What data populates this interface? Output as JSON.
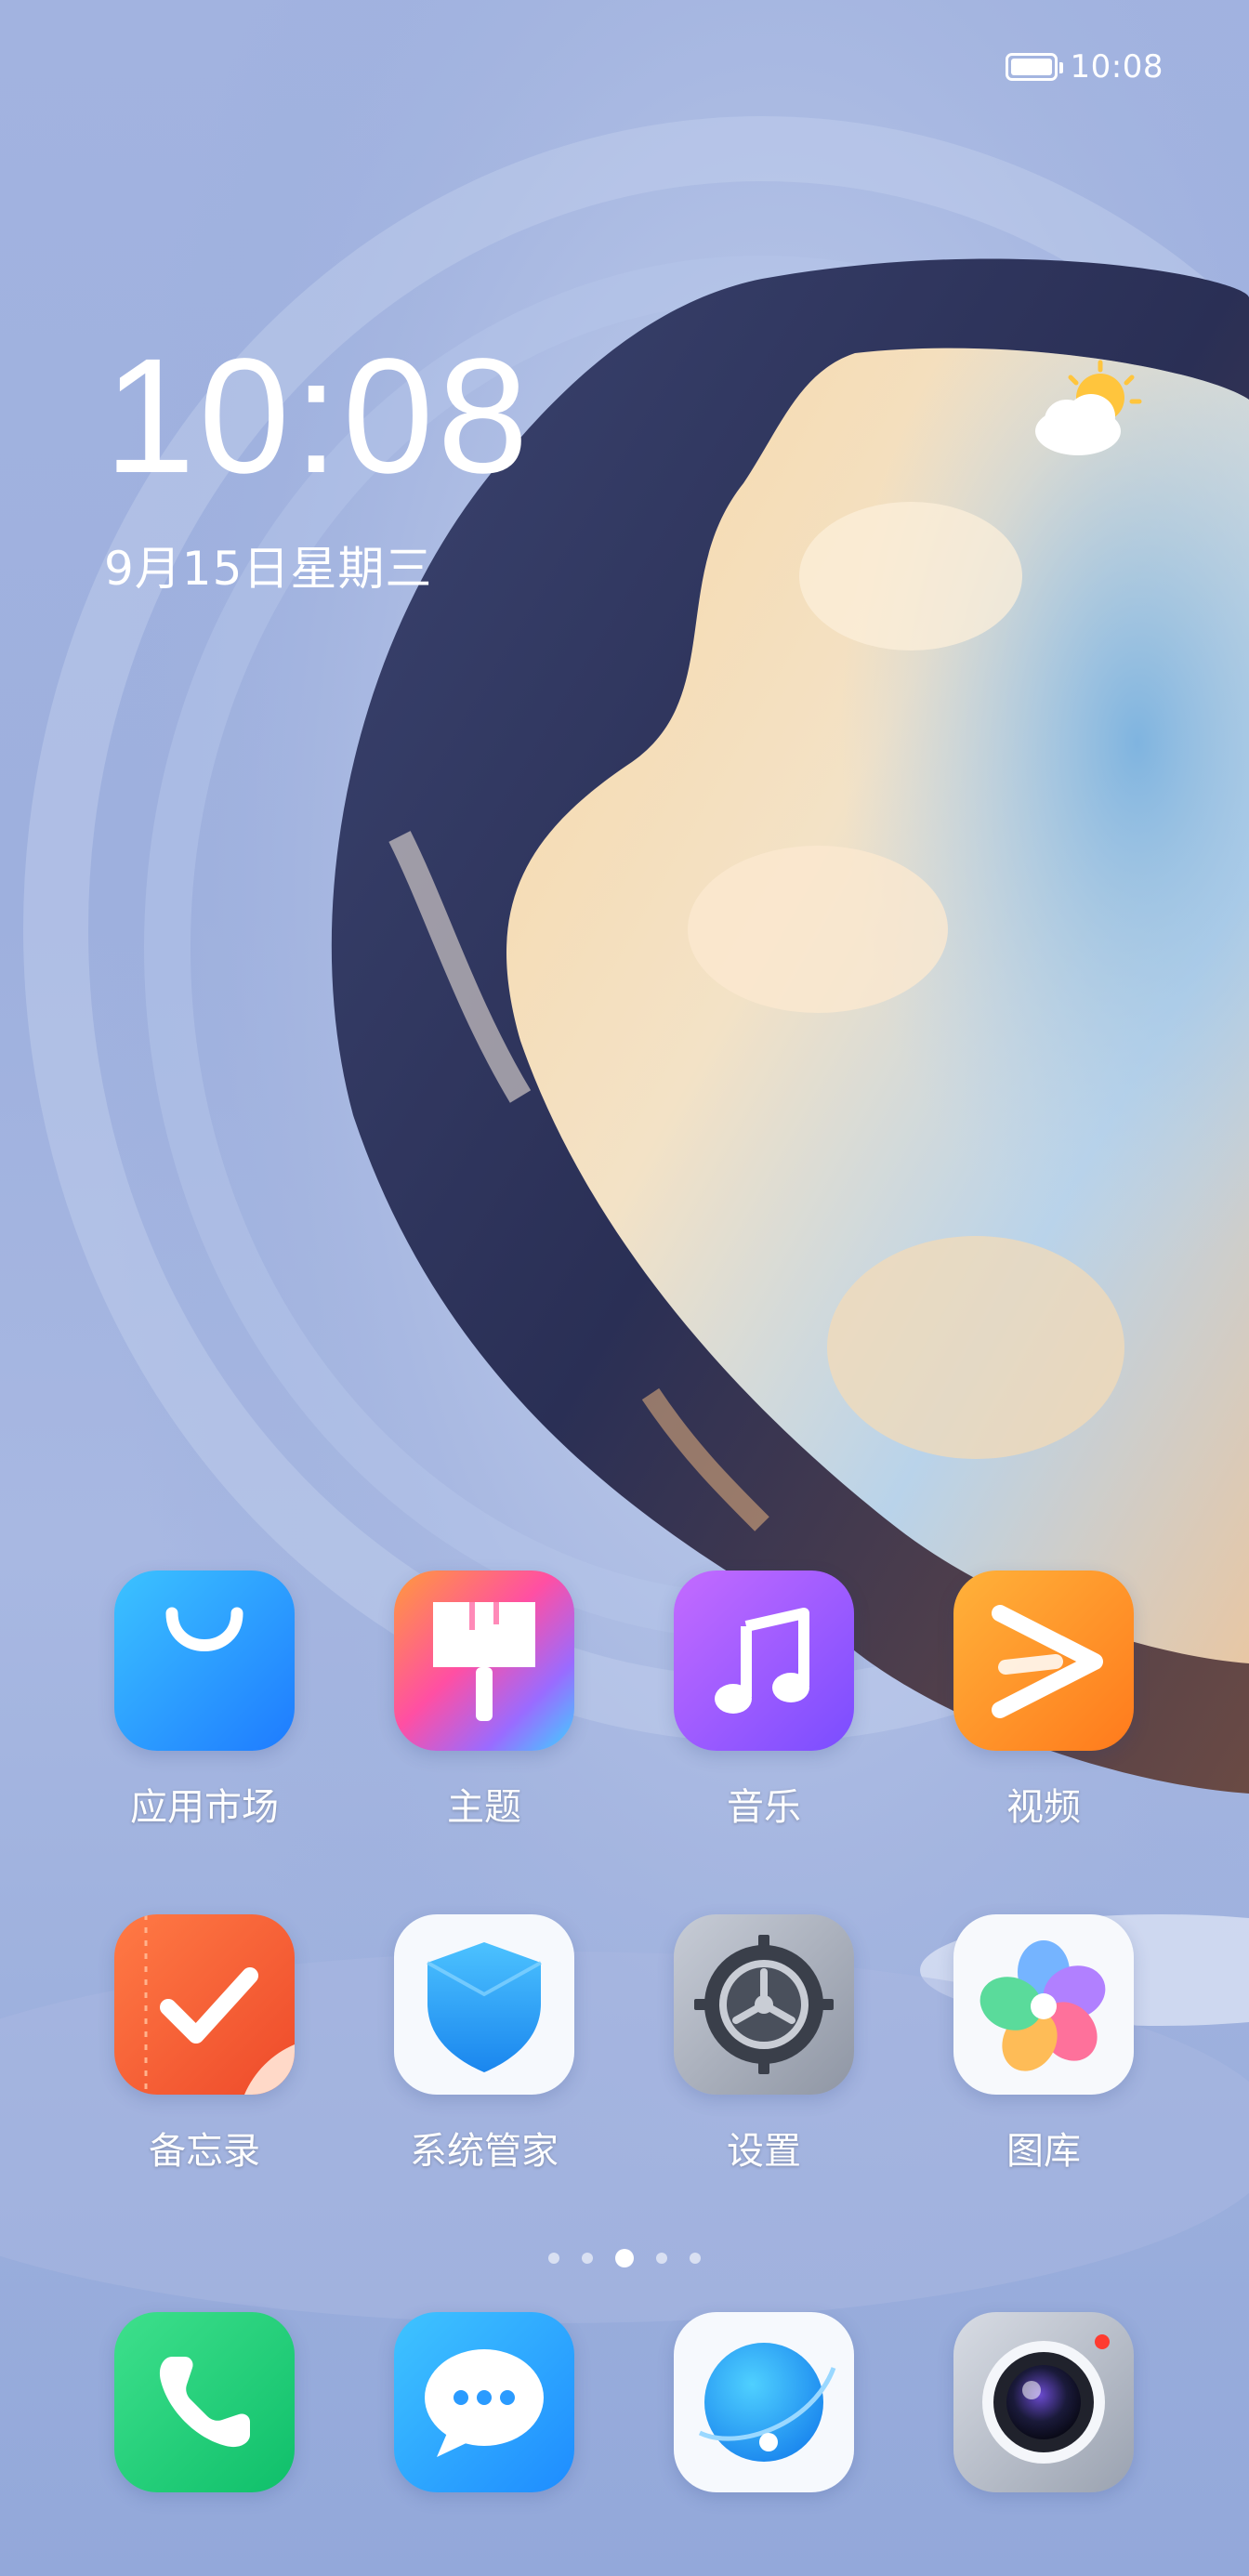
{
  "status_bar": {
    "time": "10:08",
    "battery_icon": "battery-icon"
  },
  "clock_widget": {
    "time": "10:08",
    "date": "9月15日星期三",
    "weather_icon": "partly-cloudy-icon"
  },
  "apps_row1": [
    {
      "label": "应用市场",
      "icon": "app-market-icon"
    },
    {
      "label": "主题",
      "icon": "themes-brush-icon"
    },
    {
      "label": "音乐",
      "icon": "music-note-icon"
    },
    {
      "label": "视频",
      "icon": "video-play-icon"
    }
  ],
  "apps_row2": [
    {
      "label": "备忘录",
      "icon": "notepad-check-icon"
    },
    {
      "label": "系统管家",
      "icon": "shield-icon"
    },
    {
      "label": "设置",
      "icon": "gear-icon"
    },
    {
      "label": "图库",
      "icon": "gallery-flower-icon"
    }
  ],
  "dock": [
    {
      "icon": "phone-icon"
    },
    {
      "icon": "messages-icon"
    },
    {
      "icon": "browser-icon"
    },
    {
      "icon": "camera-icon"
    }
  ],
  "page_indicator": {
    "count": 5,
    "active_index": 2
  },
  "colors": {
    "label_text": "#ffffff",
    "wallpaper_base": "#a2b3e0"
  }
}
